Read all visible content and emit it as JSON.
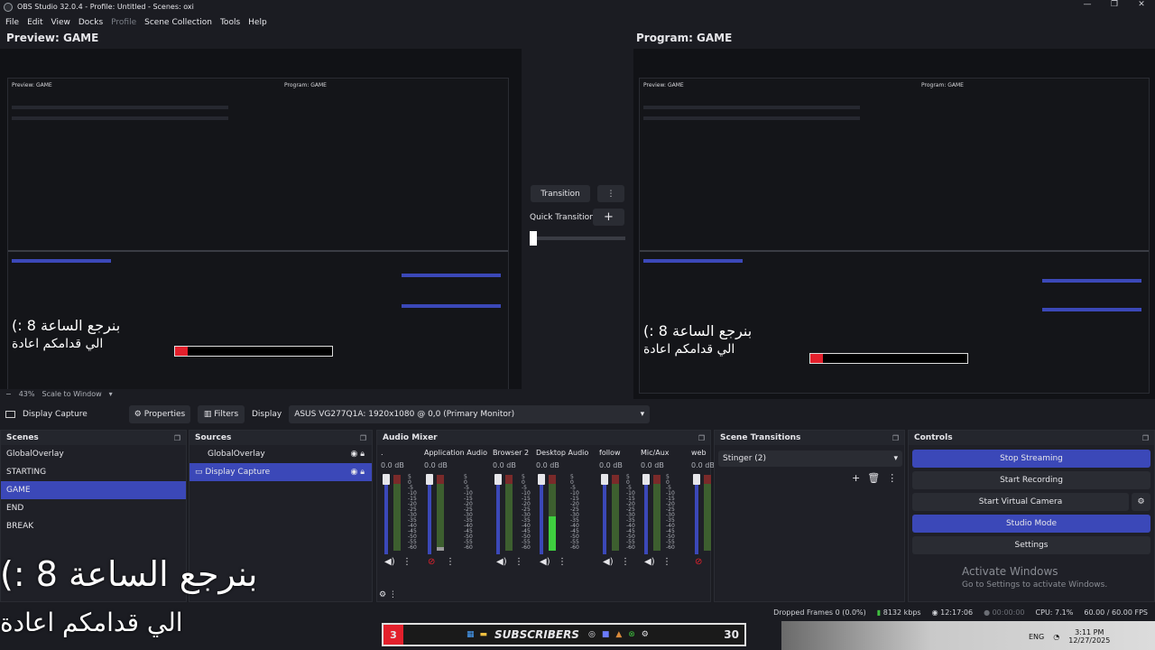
{
  "window": {
    "title": "OBS Studio 32.0.4 - Profile: Untitled - Scenes: oxi",
    "controls": [
      "—",
      "❐",
      "✕"
    ]
  },
  "menu": [
    "File",
    "Edit",
    "View",
    "Docks",
    "Profile",
    "Scene Collection",
    "Tools",
    "Help"
  ],
  "preview": {
    "label": "Preview: GAME",
    "zoom": "43%",
    "scale_mode": "Scale to Window",
    "minus": "−"
  },
  "program": {
    "label": "Program: GAME"
  },
  "transition": {
    "button": "Transition",
    "quick": "Quick Transitions",
    "plus": "+",
    "kebab": "⋮"
  },
  "overlay_text": {
    "line1": "بنرجع الساعة 8 :)",
    "line2": "الي قدامكم اعادة"
  },
  "source_bar": {
    "source_name": "Display Capture",
    "properties": "Properties",
    "filters": "Filters",
    "display_label": "Display",
    "display_value": "ASUS VG277Q1A: 1920x1080 @ 0,0 (Primary Monitor)"
  },
  "scenes": {
    "title": "Scenes",
    "items": [
      "GlobalOverlay",
      "STARTING",
      "GAME",
      "END",
      "BREAK"
    ],
    "selected": 2
  },
  "sources": {
    "title": "Sources",
    "items": [
      "GlobalOverlay",
      "Display Capture"
    ],
    "selected": 1
  },
  "audio_mixer": {
    "title": "Audio Mixer",
    "channels": [
      {
        "name": ".",
        "db": "0.0 dB",
        "level": 0.0,
        "muted": false
      },
      {
        "name": "Application Audio C",
        "db": "0.0 dB",
        "level": 0.05,
        "muted": true
      },
      {
        "name": "Browser 2",
        "db": "0.0 dB",
        "level": 0.0,
        "muted": false
      },
      {
        "name": "Desktop Audio",
        "db": "0.0 dB",
        "level": 0.45,
        "muted": false
      },
      {
        "name": "follow",
        "db": "0.0 dB",
        "level": 0.0,
        "muted": false
      },
      {
        "name": "Mic/Aux",
        "db": "0.0 dB",
        "level": 0.0,
        "muted": false
      },
      {
        "name": "web",
        "db": "0.0 dB",
        "level": 0.0,
        "muted": true
      }
    ],
    "scale": [
      "5",
      "0",
      "-5",
      "-10",
      "-15",
      "-20",
      "-25",
      "-30",
      "-35",
      "-40",
      "-45",
      "-50",
      "-55",
      "-60"
    ]
  },
  "scene_transitions": {
    "title": "Scene Transitions",
    "selected": "Stinger (2)"
  },
  "controls": {
    "title": "Controls",
    "stop_streaming": "Stop Streaming",
    "start_recording": "Start Recording",
    "start_virtual_camera": "Start Virtual Camera",
    "studio_mode": "Studio Mode",
    "settings": "Settings"
  },
  "activate": {
    "title": "Activate Windows",
    "subtitle": "Go to Settings to activate Windows."
  },
  "status": {
    "dropped_frames": "Dropped Frames 0 (0.0%)",
    "bitrate": "8132 kbps",
    "stream_time": "12:17:06",
    "record_time": "00:00:00",
    "cpu": "CPU: 7.1%",
    "fps": "60.00 / 60.00 FPS"
  },
  "taskbar": {
    "count_left": "3",
    "subscribers": "SUBSCRIBERS",
    "count_right": "30",
    "lang": "ENG",
    "time": "3:11 PM",
    "date": "12/27/2025"
  },
  "colors": {
    "accent": "#3b48b8",
    "bg": "#1b1c22",
    "panel": "#1f2027",
    "red": "#e3202c"
  }
}
